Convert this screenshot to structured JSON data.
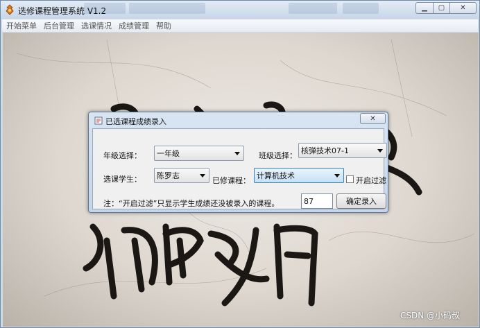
{
  "window": {
    "title": "选修课程管理系统 V1.2"
  },
  "menu": [
    "开始菜单",
    "后台管理",
    "选课情况",
    "成绩管理",
    "帮助"
  ],
  "dialog": {
    "title": "已选课程成绩录入",
    "grade_label": "年级选择：",
    "grade_value": "一年级",
    "class_label": "班级选择：",
    "class_value": "核弹技术07-1",
    "student_label": "选课学生：",
    "student_value": "陈罗志",
    "course_label": "已修课程：",
    "course_value": "计算机技术",
    "filter_label": "开启过滤",
    "note": "注：“开启过滤”只显示学生成绩还没被录入的课程。",
    "score_value": "87",
    "submit_label": "确定录入"
  },
  "watermark": "CSDN @小码叔",
  "icons": {
    "app": "app-icon",
    "dialog": "dialog-icon",
    "minimize": "minimize-icon",
    "maximize": "maximize-icon",
    "close": "close-icon",
    "dropdown": "chevron-down-icon"
  }
}
